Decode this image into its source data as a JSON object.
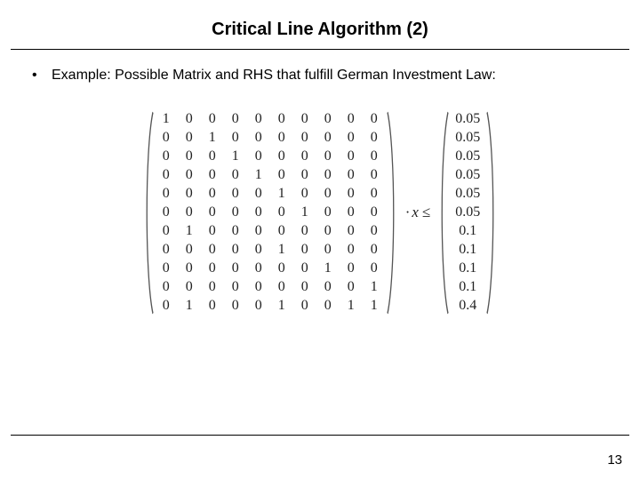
{
  "title": "Critical Line Algorithm (2)",
  "bullet_text": "Example: Possible Matrix and RHS that fulfill German Investment Law:",
  "mid_text": {
    "dot": "·",
    "x": "x",
    "leq": "≤"
  },
  "matrix": [
    [
      1,
      0,
      0,
      0,
      0,
      0,
      0,
      0,
      0,
      0
    ],
    [
      0,
      0,
      1,
      0,
      0,
      0,
      0,
      0,
      0,
      0
    ],
    [
      0,
      0,
      0,
      1,
      0,
      0,
      0,
      0,
      0,
      0
    ],
    [
      0,
      0,
      0,
      0,
      1,
      0,
      0,
      0,
      0,
      0
    ],
    [
      0,
      0,
      0,
      0,
      0,
      1,
      0,
      0,
      0,
      0
    ],
    [
      0,
      0,
      0,
      0,
      0,
      0,
      1,
      0,
      0,
      0
    ],
    [
      0,
      1,
      0,
      0,
      0,
      0,
      0,
      0,
      0,
      0
    ],
    [
      0,
      0,
      0,
      0,
      0,
      1,
      0,
      0,
      0,
      0
    ],
    [
      0,
      0,
      0,
      0,
      0,
      0,
      0,
      1,
      0,
      0
    ],
    [
      0,
      0,
      0,
      0,
      0,
      0,
      0,
      0,
      0,
      1
    ],
    [
      0,
      1,
      0,
      0,
      0,
      1,
      0,
      0,
      1,
      1
    ]
  ],
  "rhs": [
    "0.05",
    "0.05",
    "0.05",
    "0.05",
    "0.05",
    "0.05",
    "0.1",
    "0.1",
    "0.1",
    "0.1",
    "0.4"
  ],
  "page_number": "13"
}
